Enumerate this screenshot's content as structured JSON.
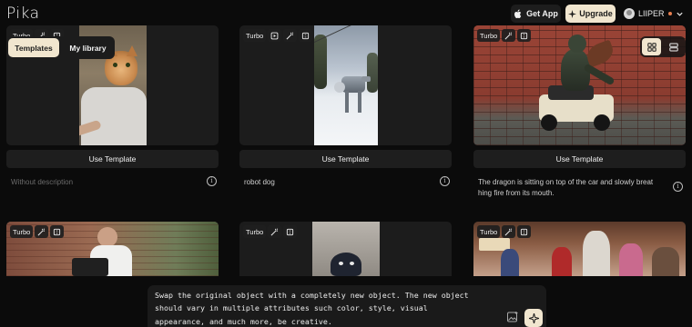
{
  "header": {
    "logo": "Pika",
    "get_app": "Get App",
    "upgrade": "Upgrade",
    "username": "LIIPER"
  },
  "tabs": [
    {
      "label": "Templates",
      "active": true
    },
    {
      "label": "My library",
      "active": false
    }
  ],
  "view_toggle": {
    "active": "grid"
  },
  "cards": [
    {
      "chips": [
        "Turbo"
      ],
      "button": "Use Template",
      "description": "Without description",
      "description_muted": true
    },
    {
      "chips": [
        "Turbo"
      ],
      "button": "Use Template",
      "description": "robot dog",
      "description_muted": false
    },
    {
      "chips": [
        "Turbo"
      ],
      "button": "Use Template",
      "description_lines": [
        "The dragon is sitting on top of the car and slowly breat",
        "hing fire from its mouth."
      ],
      "description_muted": false
    },
    {
      "chips": [
        "Turbo"
      ]
    },
    {
      "chips": [
        "Turbo"
      ]
    },
    {
      "chips": [
        "Turbo"
      ]
    }
  ],
  "prompt": {
    "lines": [
      "Swap the original object with a completely new object. The new object",
      "should vary in multiple attributes such color, style, visual",
      "appearance, and much more, be creative."
    ]
  },
  "colors": {
    "background": "#0b0b0b",
    "accent": "#f1e6cf",
    "card": "#1c1c1c"
  }
}
